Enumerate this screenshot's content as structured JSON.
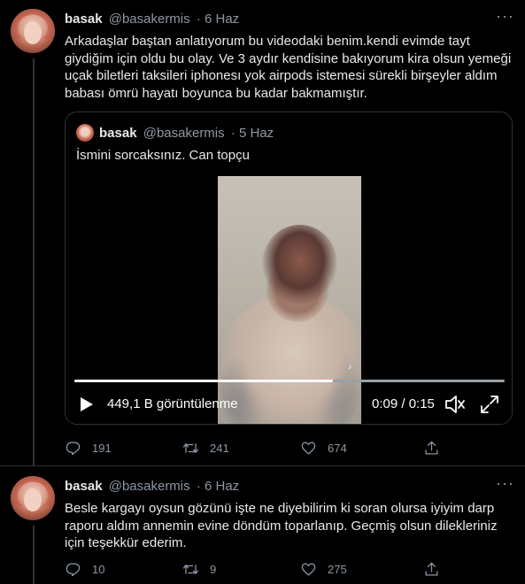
{
  "tweet1": {
    "name": "basak",
    "handle": "@basakermis",
    "date": "· 6 Haz",
    "more": "···",
    "text": "Arkadaşlar baştan anlatıyorum bu videodaki benim.kendi evimde tayt giydiğim için oldu bu olay. Ve 3 aydır kendisine bakıyorum kira olsun yemeği uçak biletleri taksileri iphonesı yok airpods istemesi sürekli birşeyler aldım babası ömrü hayatı boyunca bu kadar bakmamıştır.",
    "quote": {
      "name": "basak",
      "handle": "@basakermis",
      "date": "· 5 Haz",
      "text": "İsmini sorcaksınız. Can topçu",
      "video": {
        "views": "449,1 B görüntülenme",
        "time": "0:09 / 0:15",
        "progress": 0.6
      }
    },
    "actions": {
      "reply": "191",
      "retweet": "241",
      "like": "674"
    }
  },
  "tweet2": {
    "name": "basak",
    "handle": "@basakermis",
    "date": "· 6 Haz",
    "more": "···",
    "text": "Besle kargayı oysun gözünü işte ne diyebilirim ki soran olursa iyiyim darp raporu aldım annemin evine döndüm toparlanıp. Geçmiş olsun dilekleriniz için teşekkür ederim.",
    "actions": {
      "reply": "10",
      "retweet": "9",
      "like": "275"
    }
  },
  "colors": {
    "background": "#000000",
    "text": "#e7e9ea",
    "muted": "#8b98a5",
    "border": "#2f3336"
  }
}
